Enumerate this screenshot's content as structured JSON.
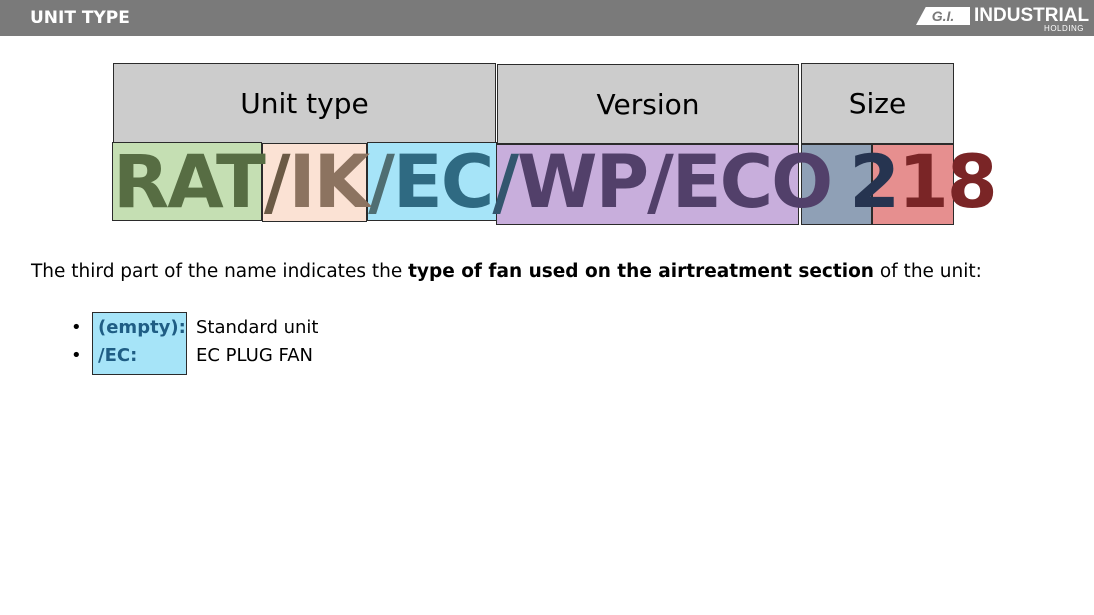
{
  "header": {
    "title": "UNIT TYPE",
    "logo_mark": "G.I.",
    "logo_text": "INDUSTRIAL",
    "logo_sub": "HOLDING"
  },
  "diagram": {
    "headers": {
      "unit_type": "Unit type",
      "version": "Version",
      "size": "Size"
    },
    "code_parts": [
      {
        "text": "RAT",
        "color": "#576d43"
      },
      {
        "text": "/",
        "color": "#6b5a45"
      },
      {
        "text": "IK",
        "color": "#8c7360"
      },
      {
        "text": "/",
        "color": "#4f6e72"
      },
      {
        "text": "EC",
        "color": "#2f6a82"
      },
      {
        "text": "/",
        "color": "#33566e"
      },
      {
        "text": "WP/ECO",
        "color": "#52406a"
      },
      {
        "text": " ",
        "color": "#000000"
      },
      {
        "text": "2",
        "color": "#263450"
      },
      {
        "text": "18",
        "color": "#7a2526"
      }
    ],
    "colors": {
      "rat_bg": "#c5dfb3",
      "ik_bg": "#fbe2d4",
      "ec_bg": "#a6e4f8",
      "wp_bg": "#c8aedc",
      "size1_bg": "#8fa0b6",
      "size2_bg": "#e68f8f",
      "header_bg": "#cccccc"
    }
  },
  "intro": {
    "before": "The third part of the name indicates the ",
    "bold": "type of fan used on the airtreatment section",
    "after": " of the unit:"
  },
  "list": [
    {
      "bullet": "•",
      "key": "(empty):",
      "value": "Standard unit"
    },
    {
      "bullet": "•",
      "key": "/EC:",
      "value": "EC PLUG FAN"
    }
  ]
}
